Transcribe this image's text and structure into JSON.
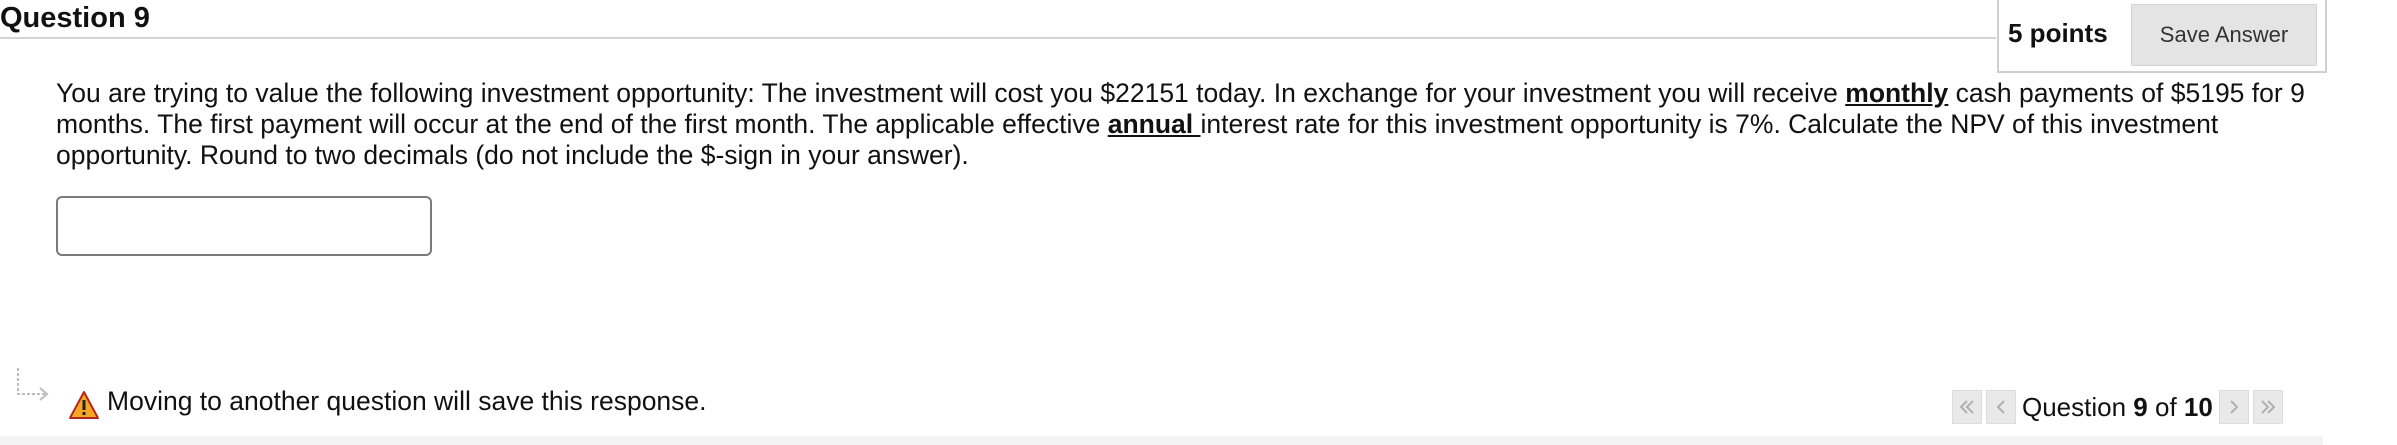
{
  "header": {
    "title": "Question 9",
    "points": "5 points",
    "save_label": "Save Answer"
  },
  "question": {
    "text_1": "You are trying to value the following investment opportunity: The investment will cost you $22151 today. In exchange for your investment you will receive ",
    "emph_1": "monthly",
    "text_2": " cash payments of $5195 for 9 months. The first payment will occur at the end of the first month. The applicable effective ",
    "emph_2": "annual ",
    "text_3": "interest rate for this investment opportunity is 7%. Calculate the NPV of this investment opportunity. Round to two decimals (do not include the $-sign in your answer).",
    "answer_value": ""
  },
  "footer": {
    "message": "Moving to another question will save this response.",
    "nav_prefix": "Question ",
    "nav_current": "9",
    "nav_middle": " of ",
    "nav_total": "10"
  },
  "icons": {
    "connector": "connector-arrow-icon",
    "warning": "warning-triangle-icon",
    "first": "double-chevron-left-icon",
    "prev": "chevron-left-icon",
    "next": "chevron-right-icon",
    "last": "double-chevron-right-icon"
  },
  "colors": {
    "warning_fill": "#f5a623",
    "warning_stroke": "#b4261e",
    "nav_button": "#e9e9e9",
    "save_button": "#e4e4e4"
  }
}
